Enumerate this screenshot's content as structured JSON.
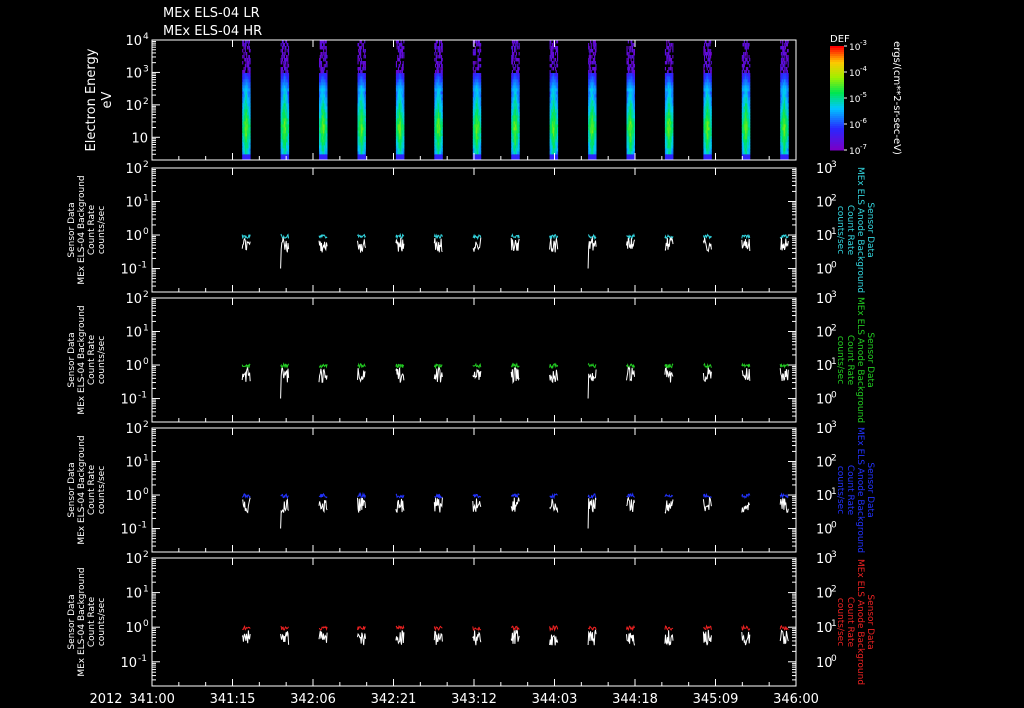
{
  "titles": [
    "MEx ELS-04 LR",
    "MEx ELS-04 HR"
  ],
  "spectrogram": {
    "ylabel": "Electron Energy",
    "yunit": "eV",
    "yticks": [
      {
        "mant": "10",
        "exp": "4",
        "value": 4
      },
      {
        "mant": "10",
        "exp": "3",
        "value": 3
      },
      {
        "mant": "10",
        "exp": "2",
        "value": 2
      },
      {
        "mant": "10",
        "exp": "",
        "value": 1
      }
    ],
    "ylim_log10": [
      0.3,
      4
    ],
    "colorbar": {
      "label": "DEF",
      "units": "ergs/(cm**2-sr-sec-eV)",
      "ticks": [
        {
          "mant": "10",
          "exp": "-3",
          "value": -3
        },
        {
          "mant": "10",
          "exp": "-4",
          "value": -4
        },
        {
          "mant": "10",
          "exp": "-5",
          "value": -5
        },
        {
          "mant": "10",
          "exp": "-6",
          "value": -6
        },
        {
          "mant": "10",
          "exp": "-7",
          "value": -7
        }
      ],
      "range_log10": [
        -7,
        -3
      ]
    }
  },
  "count_panels": [
    {
      "left_label": [
        "Sensor Data",
        "MEx ELS-04 Background",
        "Count Rate",
        "counts/sec"
      ],
      "right_label": [
        "Sensor Data",
        "MEx ELS Anode Background",
        "Count Rate",
        "counts/sec"
      ],
      "color": "#33d6e0",
      "background_level": 0.9
    },
    {
      "left_label": [
        "Sensor Data",
        "MEx ELS-04 Background",
        "Count Rate",
        "counts/sec"
      ],
      "right_label": [
        "Sensor Data",
        "MEx ELS Anode Background",
        "Count Rate",
        "counts/sec"
      ],
      "color": "#22cc22",
      "background_level": 0.95
    },
    {
      "left_label": [
        "Sensor Data",
        "MEx ELS-04 Background",
        "Count Rate",
        "counts/sec"
      ],
      "right_label": [
        "Sensor Data",
        "MEx ELS Anode Background",
        "Count Rate",
        "counts/sec"
      ],
      "color": "#2233ff",
      "background_level": 0.95
    },
    {
      "left_label": [
        "Sensor Data",
        "MEx ELS-04 Background",
        "Count Rate",
        "counts/sec"
      ],
      "right_label": [
        "Sensor Data",
        "MEx ELS Anode Background",
        "Count Rate",
        "counts/sec"
      ],
      "color": "#ee2222",
      "background_level": 0.95
    }
  ],
  "count_axis": {
    "left_ticks": [
      {
        "mant": "10",
        "exp": "2",
        "value": 2
      },
      {
        "mant": "10",
        "exp": "1",
        "value": 1
      },
      {
        "mant": "10",
        "exp": "0",
        "value": 0
      },
      {
        "mant": "10",
        "exp": "-1",
        "value": -1
      }
    ],
    "left_range_log10": [
      -1.7,
      2
    ],
    "right_ticks": [
      {
        "mant": "10",
        "exp": "3",
        "value": 3
      },
      {
        "mant": "10",
        "exp": "2",
        "value": 2
      },
      {
        "mant": "10",
        "exp": "1",
        "value": 1
      },
      {
        "mant": "10",
        "exp": "0",
        "value": 0
      }
    ]
  },
  "x_axis": {
    "year": "2012",
    "tick_labels": [
      "341:00",
      "341:15",
      "342:06",
      "342:21",
      "343:12",
      "344:03",
      "344:18",
      "345:09",
      "346:00"
    ]
  },
  "chart_data": {
    "type": "heatmap",
    "x_range_days": [
      341.0,
      346.0
    ],
    "data_interval_start_days": 341.7,
    "passes": 15,
    "pass_duration_hours": 1.5,
    "spectrogram_energy_range_eV": [
      2,
      10000
    ],
    "count_rate_white_typical": 0.5,
    "count_rate_background_typical": 0.9
  }
}
